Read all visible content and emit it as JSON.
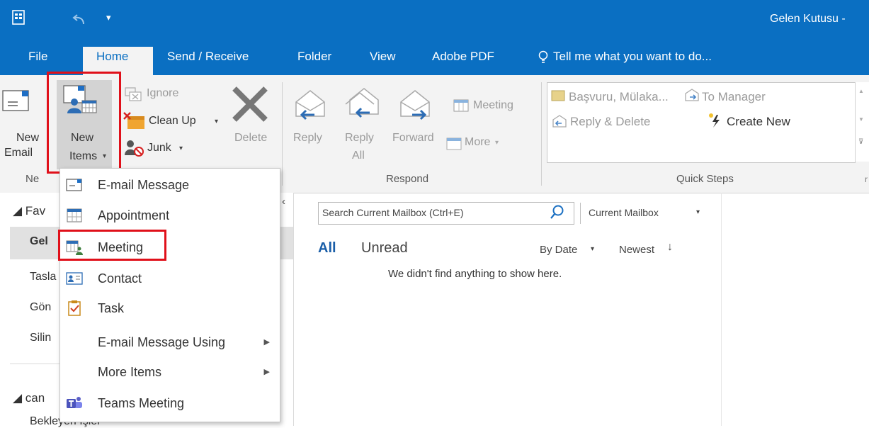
{
  "window": {
    "title": "Gelen Kutusu -"
  },
  "tabs": [
    "File",
    "Home",
    "Send / Receive",
    "Folder",
    "View",
    "Adobe PDF"
  ],
  "tell_me": "Tell me what you want to do...",
  "ribbon": {
    "new_group": {
      "new_email_line1": "New",
      "new_email_line2": "Email",
      "new_items_line1": "New",
      "new_items_line2": "Items",
      "group_label_partial": "Ne"
    },
    "delete_group": {
      "ignore": "Ignore",
      "clean_up": "Clean Up",
      "junk": "Junk",
      "delete": "Delete"
    },
    "respond": {
      "reply": "Reply",
      "reply_all_line1": "Reply",
      "reply_all_line2": "All",
      "forward": "Forward",
      "meeting": "Meeting",
      "more": "More",
      "group_label": "Respond"
    },
    "quick_steps": {
      "item1": "Başvuru, Mülaka...",
      "item2": "To Manager",
      "item3": "Reply & Delete",
      "item4": "Create New",
      "group_label": "Quick Steps"
    }
  },
  "left_pane": {
    "favorites_partial": "Fav",
    "folders": [
      "Gel",
      "Tasla",
      "Gön",
      "Silin"
    ],
    "account_partial": "can",
    "bottom_partial": "Bekleyen İşler"
  },
  "new_items_menu": {
    "items": [
      {
        "label": "E-mail Message",
        "icon": "email-message-icon"
      },
      {
        "label": "Appointment",
        "icon": "appointment-icon"
      },
      {
        "label": "Meeting",
        "icon": "meeting-icon"
      },
      {
        "label": "Contact",
        "icon": "contact-icon"
      },
      {
        "label": "Task",
        "icon": "task-icon"
      },
      {
        "label": "E-mail Message Using",
        "submenu": true
      },
      {
        "label": "More Items",
        "submenu": true
      },
      {
        "label": "Teams Meeting",
        "icon": "teams-icon"
      }
    ]
  },
  "mail_list": {
    "search_placeholder": "Search Current Mailbox (Ctrl+E)",
    "scope": "Current Mailbox",
    "filter_all": "All",
    "filter_unread": "Unread",
    "sort_by": "By Date",
    "order": "Newest",
    "empty_message": "We didn't find anything to show here."
  },
  "colors": {
    "accent": "#0a6fc2",
    "highlight_box": "#e0101a"
  }
}
